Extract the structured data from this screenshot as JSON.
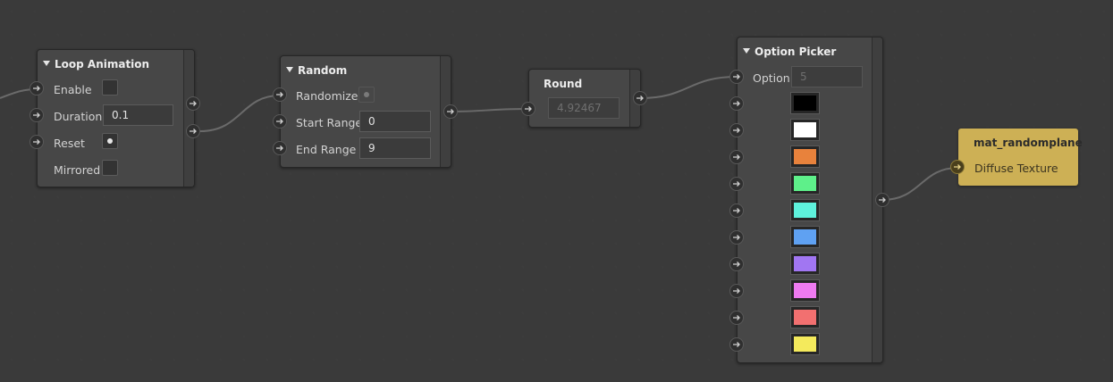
{
  "nodes": {
    "loop_animation": {
      "title": "Loop Animation",
      "enable_label": "Enable",
      "duration_label": "Duration",
      "duration_value": "0.1",
      "reset_label": "Reset",
      "mirrored_label": "Mirrored"
    },
    "random": {
      "title": "Random",
      "randomize_label": "Randomize",
      "start_label": "Start Range",
      "start_value": "0",
      "end_label": "End Range",
      "end_value": "9"
    },
    "round": {
      "title": "Round",
      "value": "4.92467"
    },
    "option_picker": {
      "title": "Option Picker",
      "option_label": "Option",
      "option_value": "5",
      "colors": [
        "#000000",
        "#ffffff",
        "#e8823c",
        "#5ef08a",
        "#5ef2dc",
        "#5fa1f2",
        "#a176f2",
        "#ee7af0",
        "#f27070",
        "#f4ea5c"
      ]
    },
    "material": {
      "title": "mat_randomplane",
      "input_label": "Diffuse Texture",
      "color": "#cdb055"
    }
  }
}
